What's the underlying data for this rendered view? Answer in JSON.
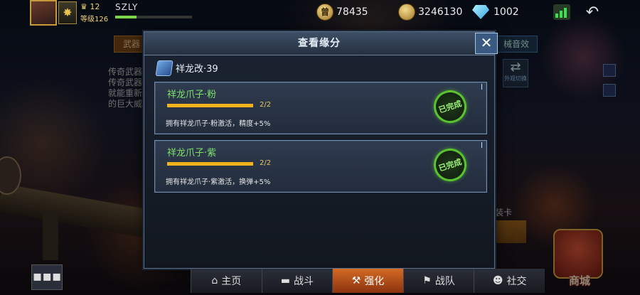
{
  "player": {
    "level": "12",
    "level_label": "等级126",
    "name": "SZLY",
    "rank_glyph": "✸"
  },
  "resources": {
    "points": "78435",
    "gold": "3246130",
    "diamonds": "1002",
    "points_icon": "coin-icon",
    "gold_icon": "gold-coin-icon",
    "diamonds_icon": "diamond-icon"
  },
  "background": {
    "tab_weapons": "武器",
    "tab_sound": "械音效",
    "description_lines": [
      "传奇武器",
      "传奇武器",
      "就能重新",
      "的巨大威"
    ],
    "skin_switch": "外观切换",
    "equip_card": "装卡",
    "shop_label": "商城"
  },
  "modal": {
    "title": "查看缘分",
    "close_glyph": "✕",
    "weapon_name": "祥龙改·39",
    "cards": [
      {
        "name": "祥龙爪子·粉",
        "progress_text": "2/2",
        "progress_value": 1.0,
        "effect": "拥有祥龙爪子·粉激活，精度+5%",
        "status": "已完成"
      },
      {
        "name": "祥龙爪子·紫",
        "progress_text": "2/2",
        "progress_value": 1.0,
        "effect": "拥有祥龙爪子·紫激活，换弹+5%",
        "status": "已完成"
      }
    ]
  },
  "nav": [
    {
      "label": "主页",
      "icon": "home-icon",
      "glyph": "⌂",
      "active": false
    },
    {
      "label": "战斗",
      "icon": "gun-icon",
      "glyph": "▬",
      "active": false
    },
    {
      "label": "强化",
      "icon": "hammer-icon",
      "glyph": "⚒",
      "active": true
    },
    {
      "label": "战队",
      "icon": "flag-icon",
      "glyph": "⚑",
      "active": false
    },
    {
      "label": "社交",
      "icon": "people-icon",
      "glyph": "☻",
      "active": false
    }
  ],
  "colors": {
    "accent_green": "#7ee06a",
    "progress": "#f2b21b",
    "active_tab": "#d36a24"
  }
}
